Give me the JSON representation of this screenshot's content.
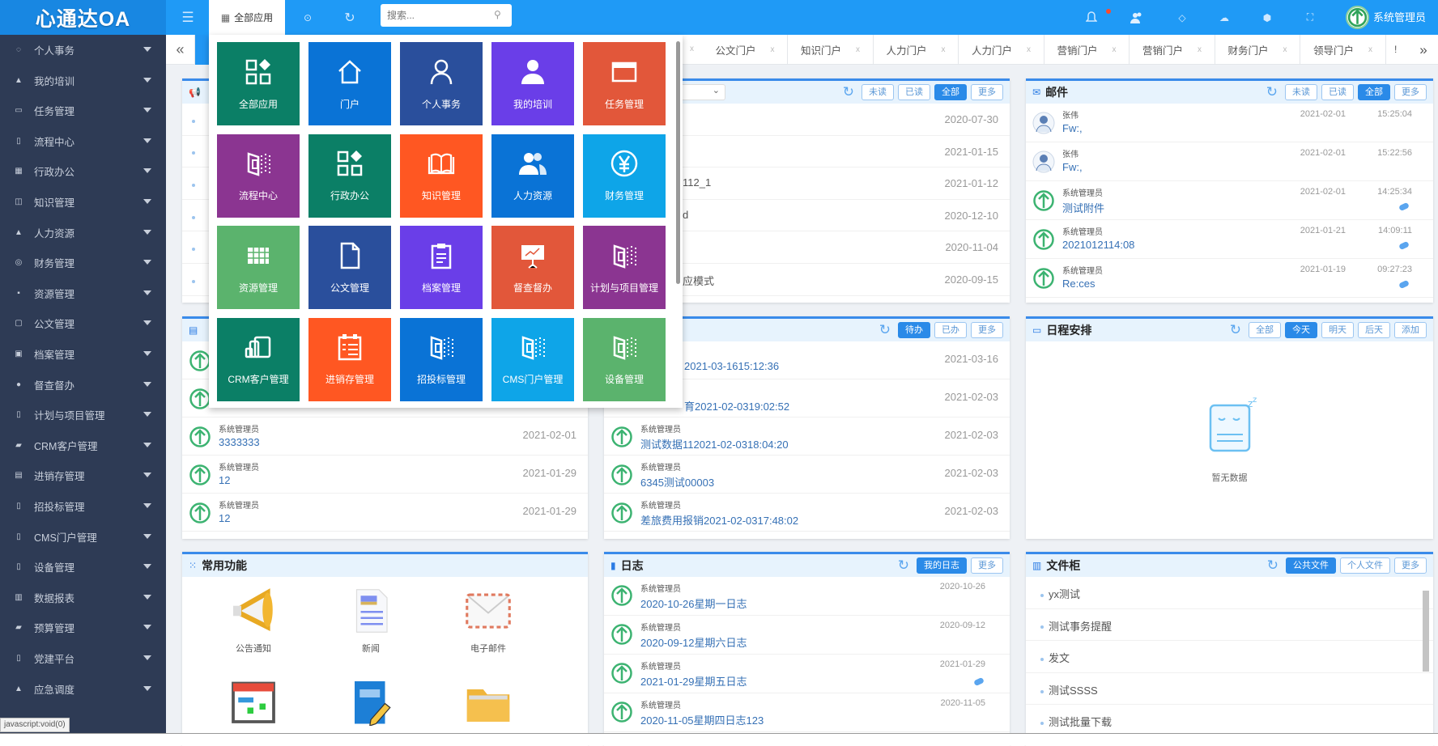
{
  "app": {
    "title": "心通达OA",
    "all_apps": "全部应用",
    "search_placeholder": "搜索...",
    "user": "系统管理员"
  },
  "colors": {
    "topbar": "#1f9af6",
    "sidebar": "#2e3b55",
    "accent": "#2a8ae8",
    "avatar_green": "#3cb371"
  },
  "topbar_icons": [
    "menu-icon",
    "skin-icon",
    "refresh-icon",
    "bell-icon",
    "contacts-icon",
    "tag-icon",
    "chat-icon",
    "box-icon",
    "fullscreen-icon"
  ],
  "sidebar": {
    "items": [
      {
        "label": "个人事务",
        "icon": "user-icon"
      },
      {
        "label": "我的培训",
        "icon": "trainee-icon"
      },
      {
        "label": "任务管理",
        "icon": "window-icon"
      },
      {
        "label": "流程中心",
        "icon": "flow-icon"
      },
      {
        "label": "行政办公",
        "icon": "apps-icon"
      },
      {
        "label": "知识管理",
        "icon": "book-icon"
      },
      {
        "label": "人力资源",
        "icon": "users-icon"
      },
      {
        "label": "财务管理",
        "icon": "yen-icon"
      },
      {
        "label": "资源管理",
        "icon": "grid-icon"
      },
      {
        "label": "公文管理",
        "icon": "file-icon"
      },
      {
        "label": "档案管理",
        "icon": "clipboard-icon"
      },
      {
        "label": "督查督办",
        "icon": "presentation-icon"
      },
      {
        "label": "计划与项目管理",
        "icon": "flow-icon"
      },
      {
        "label": "CRM客户管理",
        "icon": "devices-icon"
      },
      {
        "label": "进销存管理",
        "icon": "list-icon"
      },
      {
        "label": "招投标管理",
        "icon": "flow-icon"
      },
      {
        "label": "CMS门户管理",
        "icon": "flow-icon"
      },
      {
        "label": "设备管理",
        "icon": "flow-icon"
      },
      {
        "label": "数据报表",
        "icon": "chart-icon"
      },
      {
        "label": "预算管理",
        "icon": "devices-icon"
      },
      {
        "label": "党建平台",
        "icon": "flow-icon"
      },
      {
        "label": "应急调度",
        "icon": "users-icon"
      }
    ],
    "status_tip": "javascript:void(0)"
  },
  "portal_tabs": [
    {
      "label": "公文门户"
    },
    {
      "label": "知识门户"
    },
    {
      "label": "人力门户"
    },
    {
      "label": "人力门户"
    },
    {
      "label": "营销门户"
    },
    {
      "label": "营销门户"
    },
    {
      "label": "财务门户"
    },
    {
      "label": "领导门户"
    }
  ],
  "portal_tab_close": "x",
  "portal_tab_more": "!",
  "apps_menu": {
    "tiles": [
      {
        "label": "全部应用",
        "icon": "apps",
        "color": "#0b7f66"
      },
      {
        "label": "门户",
        "icon": "home",
        "color": "#0a73d6"
      },
      {
        "label": "个人事务",
        "icon": "user",
        "color": "#2a4f9c"
      },
      {
        "label": "我的培训",
        "icon": "person",
        "color": "#6a3ee8"
      },
      {
        "label": "任务管理",
        "icon": "window",
        "color": "#e2573a"
      },
      {
        "label": "流程中心",
        "icon": "flow",
        "color": "#8b3591"
      },
      {
        "label": "行政办公",
        "icon": "apps",
        "color": "#0b7f66"
      },
      {
        "label": "知识管理",
        "icon": "book",
        "color": "#ff5722"
      },
      {
        "label": "人力资源",
        "icon": "users",
        "color": "#0a73d6"
      },
      {
        "label": "财务管理",
        "icon": "yen",
        "color": "#0ea5e8"
      },
      {
        "label": "资源管理",
        "icon": "grid",
        "color": "#5bb36d"
      },
      {
        "label": "公文管理",
        "icon": "file",
        "color": "#2a4f9c"
      },
      {
        "label": "档案管理",
        "icon": "clipboard",
        "color": "#6a3ee8"
      },
      {
        "label": "督查督办",
        "icon": "presentation",
        "color": "#e2573a"
      },
      {
        "label": "计划与项目管理",
        "icon": "flow",
        "color": "#8b3591"
      },
      {
        "label": "CRM客户管理",
        "icon": "devices",
        "color": "#0b7f66"
      },
      {
        "label": "进销存管理",
        "icon": "list",
        "color": "#ff5722"
      },
      {
        "label": "招投标管理",
        "icon": "flow",
        "color": "#0a73d6"
      },
      {
        "label": "CMS门户管理",
        "icon": "flow",
        "color": "#0ea5e8"
      },
      {
        "label": "设备管理",
        "icon": "flow",
        "color": "#5bb36d"
      }
    ]
  },
  "notices": {
    "count": 6
  },
  "news": {
    "buttons": [
      {
        "label": "未读"
      },
      {
        "label": "已读"
      },
      {
        "label": "全部",
        "active": true
      },
      {
        "label": "更多"
      }
    ],
    "items": [
      {
        "text": "",
        "date": "2020-07-30"
      },
      {
        "text": "",
        "date": "2021-01-15"
      },
      {
        "text": "112_1",
        "date": "2021-01-12"
      },
      {
        "text": "d",
        "date": "2020-12-10"
      },
      {
        "text": "",
        "date": "2020-11-04"
      },
      {
        "text": "应模式",
        "date": "2020-09-15"
      }
    ]
  },
  "mail": {
    "title": "邮件",
    "buttons": [
      {
        "label": "未读"
      },
      {
        "label": "已读"
      },
      {
        "label": "全部",
        "active": true
      },
      {
        "label": "更多"
      }
    ],
    "items": [
      {
        "from": "张伟",
        "subject": "Fw:,",
        "date": "2021-02-01",
        "time": "15:25:04",
        "attach": false,
        "avatar": "person"
      },
      {
        "from": "张伟",
        "subject": "Fw:,",
        "date": "2021-02-01",
        "time": "15:22:56",
        "attach": false,
        "avatar": "person"
      },
      {
        "from": "系统管理员",
        "subject": "测试附件",
        "date": "2021-02-01",
        "time": "14:25:34",
        "attach": true,
        "avatar": "logo"
      },
      {
        "from": "系统管理员",
        "subject": "2021012114:08",
        "date": "2021-01-21",
        "time": "14:09:11",
        "attach": true,
        "avatar": "logo"
      },
      {
        "from": "系统管理员",
        "subject": "Re:ces",
        "date": "2021-01-19",
        "time": "09:27:23",
        "attach": true,
        "avatar": "logo"
      }
    ]
  },
  "left_list": {
    "items": [
      {
        "author": "",
        "subject": "",
        "date": ""
      },
      {
        "author": "",
        "subject": "",
        "date": ""
      },
      {
        "author": "系统管理员",
        "subject": "3333333",
        "date": "2021-02-01"
      },
      {
        "author": "系统管理员",
        "subject": "12",
        "date": "2021-01-29"
      },
      {
        "author": "系统管理员",
        "subject": "12",
        "date": "2021-01-29"
      }
    ]
  },
  "workflow": {
    "buttons": [
      {
        "label": "待办",
        "active": true
      },
      {
        "label": "已办"
      },
      {
        "label": "更多"
      }
    ],
    "items": [
      {
        "author": "",
        "subject": "2021-03-1615:12:36",
        "date": "2021-03-16",
        "covered": true
      },
      {
        "author": "",
        "subject": "育2021-02-0319:02:52",
        "date": "2021-02-03",
        "covered": true
      },
      {
        "author": "系统管理员",
        "subject": "测试数据112021-02-0318:04:20",
        "date": "2021-02-03"
      },
      {
        "author": "系统管理员",
        "subject": "6345测试00003",
        "date": "2021-02-03"
      },
      {
        "author": "系统管理员",
        "subject": "差旅费用报销2021-02-0317:48:02",
        "date": "2021-02-03"
      }
    ]
  },
  "schedule": {
    "title": "日程安排",
    "buttons": [
      {
        "label": "全部"
      },
      {
        "label": "今天",
        "active": true
      },
      {
        "label": "明天"
      },
      {
        "label": "后天"
      },
      {
        "label": "添加"
      }
    ],
    "empty": "暂无数据"
  },
  "quick": {
    "title": "常用功能",
    "items": [
      {
        "label": "公告通知",
        "icon": "megaphone"
      },
      {
        "label": "新闻",
        "icon": "news"
      },
      {
        "label": "电子邮件",
        "icon": "envelope"
      },
      {
        "label": "",
        "icon": "calendar"
      },
      {
        "label": "",
        "icon": "notebook"
      },
      {
        "label": "",
        "icon": "folder"
      }
    ]
  },
  "diary": {
    "title": "日志",
    "buttons": [
      {
        "label": "我的日志",
        "active": true
      },
      {
        "label": "更多"
      }
    ],
    "items": [
      {
        "author": "系统管理员",
        "subject": "2020-10-26星期一日志",
        "date": "2020-10-26",
        "attach": false
      },
      {
        "author": "系统管理员",
        "subject": "2020-09-12星期六日志",
        "date": "2020-09-12",
        "attach": false
      },
      {
        "author": "系统管理员",
        "subject": "2021-01-29星期五日志",
        "date": "2021-01-29",
        "attach": true
      },
      {
        "author": "系统管理员",
        "subject": "2020-11-05星期四日志123",
        "date": "2020-11-05",
        "attach": false
      }
    ]
  },
  "files": {
    "title": "文件柜",
    "buttons": [
      {
        "label": "公共文件",
        "active": true
      },
      {
        "label": "个人文件"
      },
      {
        "label": "更多"
      }
    ],
    "items": [
      {
        "label": "yx测试"
      },
      {
        "label": "测试事务提醒"
      },
      {
        "label": "发文"
      },
      {
        "label": "测试SSSS"
      },
      {
        "label": "测试批量下载"
      }
    ]
  }
}
